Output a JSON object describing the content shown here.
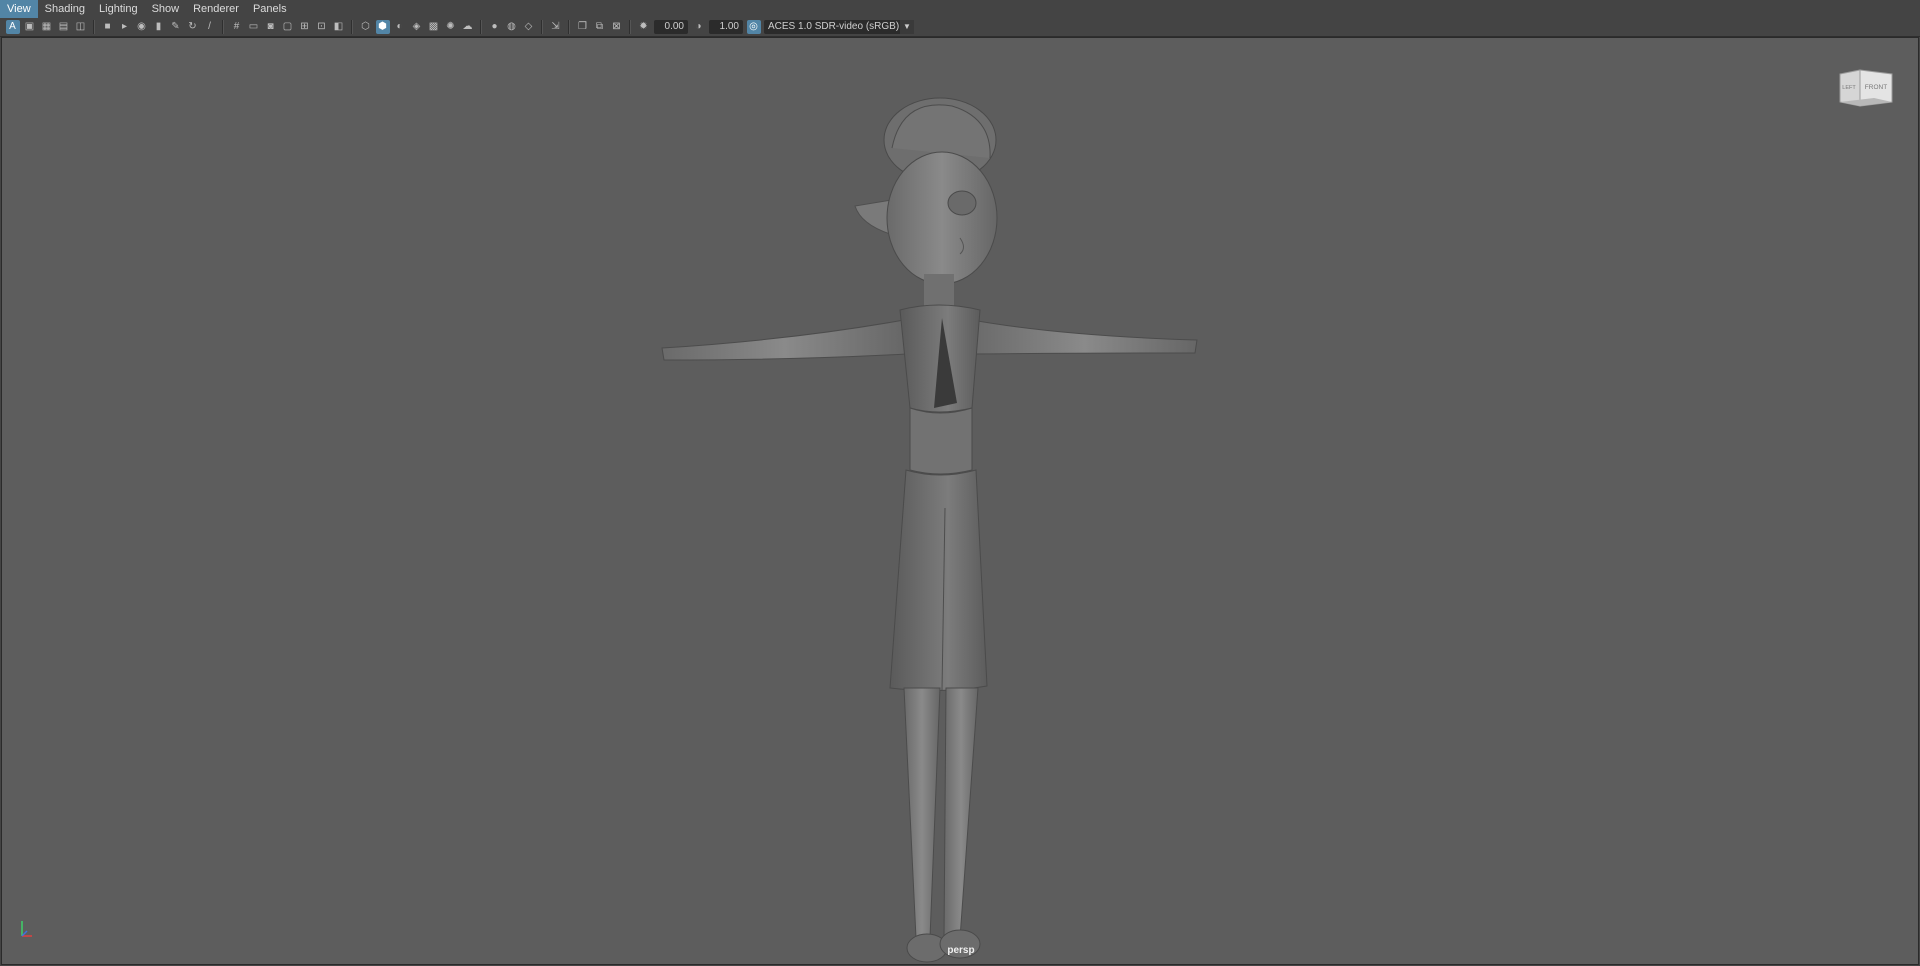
{
  "menubar": {
    "items": [
      "View",
      "Shading",
      "Lighting",
      "Show",
      "Renderer",
      "Panels"
    ],
    "active": "View"
  },
  "toolbar": {
    "exposure_value": "0.00",
    "gamma_value": "1.00",
    "color_transform": "ACES 1.0 SDR-video (sRGB)",
    "icons": [
      "select-camera-icon",
      "camera-attributes-icon",
      "bookmark-icon",
      "image-plane-icon",
      "2d-pan-zoom-icon",
      "grease-pencil-icon",
      "grid-icon",
      "film-gate-icon",
      "resolution-gate-icon",
      "gate-mask-icon",
      "field-chart-icon",
      "safe-action-icon",
      "safe-title-icon",
      "wireframe-icon",
      "smooth-shade-icon",
      "wireframe-on-shaded-icon",
      "textured-icon",
      "use-all-lights-icon",
      "shadows-icon",
      "ambient-occlusion-icon",
      "motion-blur-icon",
      "anti-aliasing-icon",
      "depth-of-field-icon",
      "isolate-select-icon",
      "xray-icon",
      "xray-active-components-icon",
      "xray-joints-icon",
      "exposure-icon",
      "gamma-icon",
      "color-management-icon"
    ]
  },
  "viewcube": {
    "left": "LEFT",
    "front": "FRONT"
  },
  "viewport": {
    "camera": "persp"
  },
  "colors": {
    "accent": "#5285a6",
    "viewport_bg": "#5d5d5d",
    "ui_bg": "#444444"
  }
}
